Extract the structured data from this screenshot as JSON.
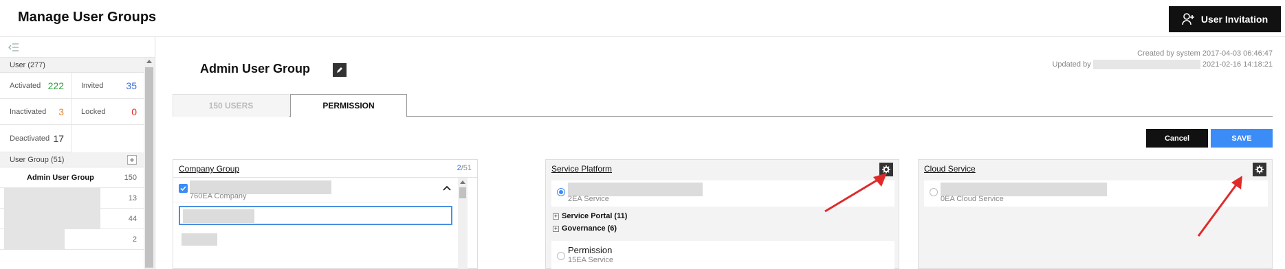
{
  "header": {
    "title": "Manage User Groups",
    "invite_label": "User Invitation"
  },
  "sidebar": {
    "user_section": "User (277)",
    "stats": [
      {
        "label": "Activated",
        "value": "222",
        "color": "#2e9e3f"
      },
      {
        "label": "Invited",
        "value": "35",
        "color": "#3b6fd6"
      },
      {
        "label": "Inactivated",
        "value": "3",
        "color": "#e0862e"
      },
      {
        "label": "Locked",
        "value": "0",
        "color": "#e02a2a"
      }
    ],
    "deactivated": {
      "label": "Deactivated",
      "value": "17"
    },
    "group_section": "User Group (51)",
    "groups": [
      {
        "name": "Admin User Group",
        "count": "150"
      },
      {
        "name": "",
        "count": "13"
      },
      {
        "name": "",
        "count": "44"
      },
      {
        "name": "",
        "count": "2"
      }
    ]
  },
  "main": {
    "group_title": "Admin User Group",
    "created": "Created by system 2017-04-03 06:46:47",
    "updated_prefix": "Updated by",
    "updated_time": "2021-02-16 14:18:21",
    "tabs": [
      {
        "label": "150 USERS"
      },
      {
        "label": "PERMISSION"
      }
    ],
    "cancel_label": "Cancel",
    "save_label": "SAVE"
  },
  "panels": {
    "company": {
      "title": "Company Group",
      "count_selected": "2",
      "count_total": "/51",
      "sub": "760EA Company"
    },
    "platform": {
      "title": "Service Platform",
      "service_sub": "2EA Service",
      "tree": [
        {
          "label": "Service Portal (11)"
        },
        {
          "label": "Governance (6)"
        }
      ],
      "permission_name": "Permission",
      "permission_sub": "15EA Service"
    },
    "cloud": {
      "title": "Cloud Service",
      "service_sub": "0EA Cloud Service"
    }
  }
}
